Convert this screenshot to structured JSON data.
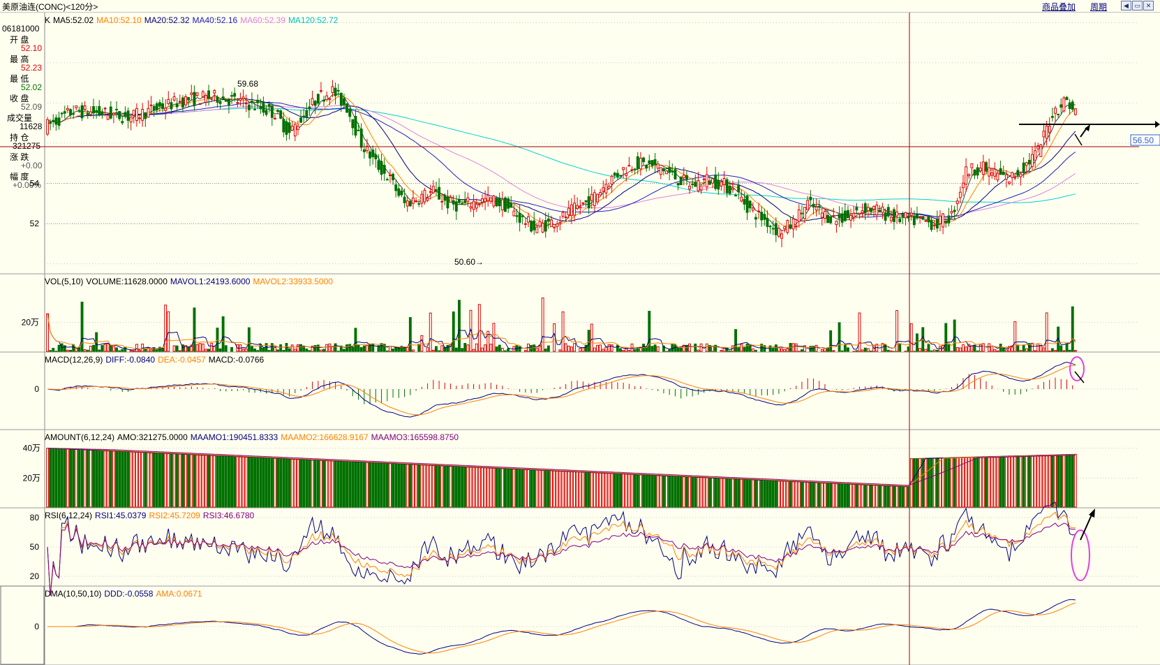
{
  "window": {
    "title": "美原油连(CONC)<120分>",
    "menu_overlay": "商品叠加",
    "menu_period": "周期"
  },
  "info_panel": {
    "date": "06181000",
    "open_label": "开  盘",
    "open": "52.10",
    "high_label": "最  高",
    "high": "52.23",
    "low_label": "最  低",
    "low": "52.02",
    "close_label": "收  盘",
    "close": "52.09",
    "volume_label": "成交量",
    "volume": "11628",
    "oi_label": "持  仓",
    "oi": "321275",
    "change_label": "涨  跌",
    "change": "+0.00",
    "pct_label": "幅  度",
    "pct": "+0.00%"
  },
  "price_label": "56.50",
  "colors": {
    "bg": "#fffff0",
    "up": "#e00000",
    "down": "#007000",
    "ma5": "#000000",
    "ma10": "#ff8000",
    "ma20": "#000080",
    "ma40": "#2020c0",
    "ma60": "#e080e0",
    "ma120": "#00d0d0",
    "annot": "#e040e0"
  },
  "chart_data": [
    {
      "type": "candlestick",
      "title": "K",
      "legend": [
        {
          "label": "K",
          "color": "#000000"
        },
        {
          "label": "MA5:52.02",
          "color": "#000000"
        },
        {
          "label": "MA10:52.10",
          "color": "#ff8000"
        },
        {
          "label": "MA20:52.32",
          "color": "#000080"
        },
        {
          "label": "MA40:52.16",
          "color": "#2020c0"
        },
        {
          "label": "MA60:52.39",
          "color": "#e080e0"
        },
        {
          "label": "MA120:52.72",
          "color": "#00c0c0"
        }
      ],
      "yticks": [
        "54",
        "52"
      ],
      "annotations": [
        "59.68",
        "50.60"
      ],
      "ylim": [
        49.5,
        62.5
      ],
      "ohlc_anchors": [
        [
          0,
          56.8
        ],
        [
          10,
          57.6
        ],
        [
          20,
          57.5
        ],
        [
          30,
          57.3
        ],
        [
          40,
          57.8
        ],
        [
          50,
          58.2
        ],
        [
          60,
          58.3
        ],
        [
          70,
          58.0
        ],
        [
          80,
          57.5
        ],
        [
          85,
          56.5
        ],
        [
          90,
          57.4
        ],
        [
          95,
          58.3
        ],
        [
          100,
          58.6
        ],
        [
          105,
          57.8
        ],
        [
          110,
          56.0
        ],
        [
          115,
          55.0
        ],
        [
          120,
          54.2
        ],
        [
          125,
          53.0
        ],
        [
          130,
          53.3
        ],
        [
          135,
          53.6
        ],
        [
          140,
          53.0
        ],
        [
          145,
          52.9
        ],
        [
          150,
          53.1
        ],
        [
          155,
          53.2
        ],
        [
          160,
          52.9
        ],
        [
          165,
          52.3
        ],
        [
          170,
          51.8
        ],
        [
          175,
          52.0
        ],
        [
          180,
          52.3
        ],
        [
          185,
          52.8
        ],
        [
          190,
          53.2
        ],
        [
          195,
          54.0
        ],
        [
          200,
          54.6
        ],
        [
          205,
          55.0
        ],
        [
          210,
          54.9
        ],
        [
          215,
          54.7
        ],
        [
          220,
          54.2
        ],
        [
          225,
          53.9
        ],
        [
          230,
          54.2
        ],
        [
          235,
          54.0
        ],
        [
          240,
          53.6
        ],
        [
          245,
          52.7
        ],
        [
          250,
          52.2
        ],
        [
          255,
          51.6
        ],
        [
          260,
          52.0
        ],
        [
          265,
          53.0
        ],
        [
          270,
          52.5
        ],
        [
          275,
          52.2
        ],
        [
          280,
          52.4
        ],
        [
          285,
          52.8
        ],
        [
          290,
          52.6
        ],
        [
          295,
          52.3
        ],
        [
          300,
          52.2
        ],
        [
          305,
          52.1
        ],
        [
          310,
          52.0
        ],
        [
          315,
          52.4
        ],
        [
          320,
          54.6
        ],
        [
          325,
          54.8
        ],
        [
          330,
          54.5
        ],
        [
          335,
          54.2
        ],
        [
          340,
          54.8
        ],
        [
          345,
          55.6
        ],
        [
          350,
          57.5
        ],
        [
          355,
          58.2
        ],
        [
          358,
          57.3
        ]
      ],
      "n_candles": 358
    },
    {
      "type": "bar",
      "title": "VOL(5,10)",
      "legend": [
        {
          "label": "VOL(5,10)",
          "color": "#000000"
        },
        {
          "label": "VOLUME:11628.0000",
          "color": "#000000"
        },
        {
          "label": "MAVOL1:24193.6000",
          "color": "#000080"
        },
        {
          "label": "MAVOL2:33933.5000",
          "color": "#ff8000"
        }
      ],
      "yticks": [
        "20万"
      ]
    },
    {
      "type": "bar",
      "title": "MACD(12,26,9)",
      "legend": [
        {
          "label": "MACD(12,26,9)",
          "color": "#000000"
        },
        {
          "label": "DIFF:-0.0840",
          "color": "#000080"
        },
        {
          "label": "DEA:-0.0457",
          "color": "#ff8000"
        },
        {
          "label": "MACD:-0.0766",
          "color": "#000000"
        }
      ],
      "yticks": [
        "0"
      ]
    },
    {
      "type": "bar",
      "title": "AMOUNT(6,12,24)",
      "legend": [
        {
          "label": "AMOUNT(6,12,24)",
          "color": "#000000"
        },
        {
          "label": "AMO:321275.0000",
          "color": "#000000"
        },
        {
          "label": "MAAMO1:190451.8333",
          "color": "#000080"
        },
        {
          "label": "MAAMO2:166628.9167",
          "color": "#ff8000"
        },
        {
          "label": "MAAMO3:165598.8750",
          "color": "#800080"
        }
      ],
      "yticks": [
        "40万",
        "20万"
      ]
    },
    {
      "type": "line",
      "title": "RSI(6,12,24)",
      "legend": [
        {
          "label": "RSI(6,12,24)",
          "color": "#000000"
        },
        {
          "label": "RSI1:45.0379",
          "color": "#000080"
        },
        {
          "label": "RSI2:45.7209",
          "color": "#ff8000"
        },
        {
          "label": "RSI3:46.6780",
          "color": "#800080"
        }
      ],
      "yticks": [
        "80",
        "50",
        "20"
      ],
      "ylim": [
        10,
        90
      ]
    },
    {
      "type": "line",
      "title": "DMA(10,50,10)",
      "legend": [
        {
          "label": "DMA(10,50,10)",
          "color": "#000000"
        },
        {
          "label": "DDD:-0.0558",
          "color": "#000080"
        },
        {
          "label": "AMA:0.0671",
          "color": "#ff8000"
        }
      ],
      "yticks": [
        "0"
      ]
    }
  ]
}
